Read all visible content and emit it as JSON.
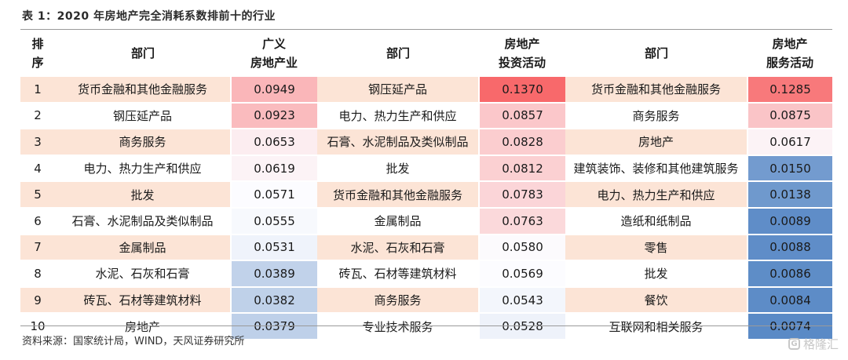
{
  "title": "表 1：2020 年房地产完全消耗系数排前十的行业",
  "headers": {
    "rank": [
      "排",
      "序"
    ],
    "dept1": "部门",
    "broad": [
      "广义",
      "房地产业"
    ],
    "dept2": "部门",
    "invest": [
      "房地产",
      "投资活动"
    ],
    "dept3": "部门",
    "service": [
      "房地产",
      "服务活动"
    ]
  },
  "rows": [
    {
      "rank": "1",
      "d1": "货币金融和其他金融服务",
      "v1": "0.0949",
      "d2": "钢压延产品",
      "v2": "0.1370",
      "d3": "货币金融和其他金融服务",
      "v3": "0.1285"
    },
    {
      "rank": "2",
      "d1": "钢压延产品",
      "v1": "0.0923",
      "d2": "电力、热力生产和供应",
      "v2": "0.0857",
      "d3": "商务服务",
      "v3": "0.0875"
    },
    {
      "rank": "3",
      "d1": "商务服务",
      "v1": "0.0653",
      "d2": "石膏、水泥制品及类似制品",
      "v2": "0.0828",
      "d3": "房地产",
      "v3": "0.0617"
    },
    {
      "rank": "4",
      "d1": "电力、热力生产和供应",
      "v1": "0.0619",
      "d2": "批发",
      "v2": "0.0812",
      "d3": "建筑装饰、装修和其他建筑服务",
      "v3": "0.0150"
    },
    {
      "rank": "5",
      "d1": "批发",
      "v1": "0.0571",
      "d2": "货币金融和其他金融服务",
      "v2": "0.0783",
      "d3": "电力、热力生产和供应",
      "v3": "0.0138"
    },
    {
      "rank": "6",
      "d1": "石膏、水泥制品及类似制品",
      "v1": "0.0555",
      "d2": "金属制品",
      "v2": "0.0763",
      "d3": "造纸和纸制品",
      "v3": "0.0089"
    },
    {
      "rank": "7",
      "d1": "金属制品",
      "v1": "0.0531",
      "d2": "水泥、石灰和石膏",
      "v2": "0.0580",
      "d3": "零售",
      "v3": "0.0088"
    },
    {
      "rank": "8",
      "d1": "水泥、石灰和石膏",
      "v1": "0.0389",
      "d2": "砖瓦、石材等建筑材料",
      "v2": "0.0569",
      "d3": "批发",
      "v3": "0.0086"
    },
    {
      "rank": "9",
      "d1": "砖瓦、石材等建筑材料",
      "v1": "0.0382",
      "d2": "商务服务",
      "v2": "0.0543",
      "d3": "餐饮",
      "v3": "0.0084"
    },
    {
      "rank": "10",
      "d1": "房地产",
      "v1": "0.0379",
      "d2": "专业技术服务",
      "v2": "0.0528",
      "d3": "互联网和相关服务",
      "v3": "0.0074"
    }
  ],
  "colors": {
    "band": "#fce4d6",
    "scale_high": "#f8696b",
    "scale_mid": "#fcfcff",
    "scale_low": "#5a8ac6"
  },
  "source": "资料来源：国家统计局，WIND，天风证券研究所",
  "watermark": "格隆汇",
  "watermark_logo_icon": "G"
}
